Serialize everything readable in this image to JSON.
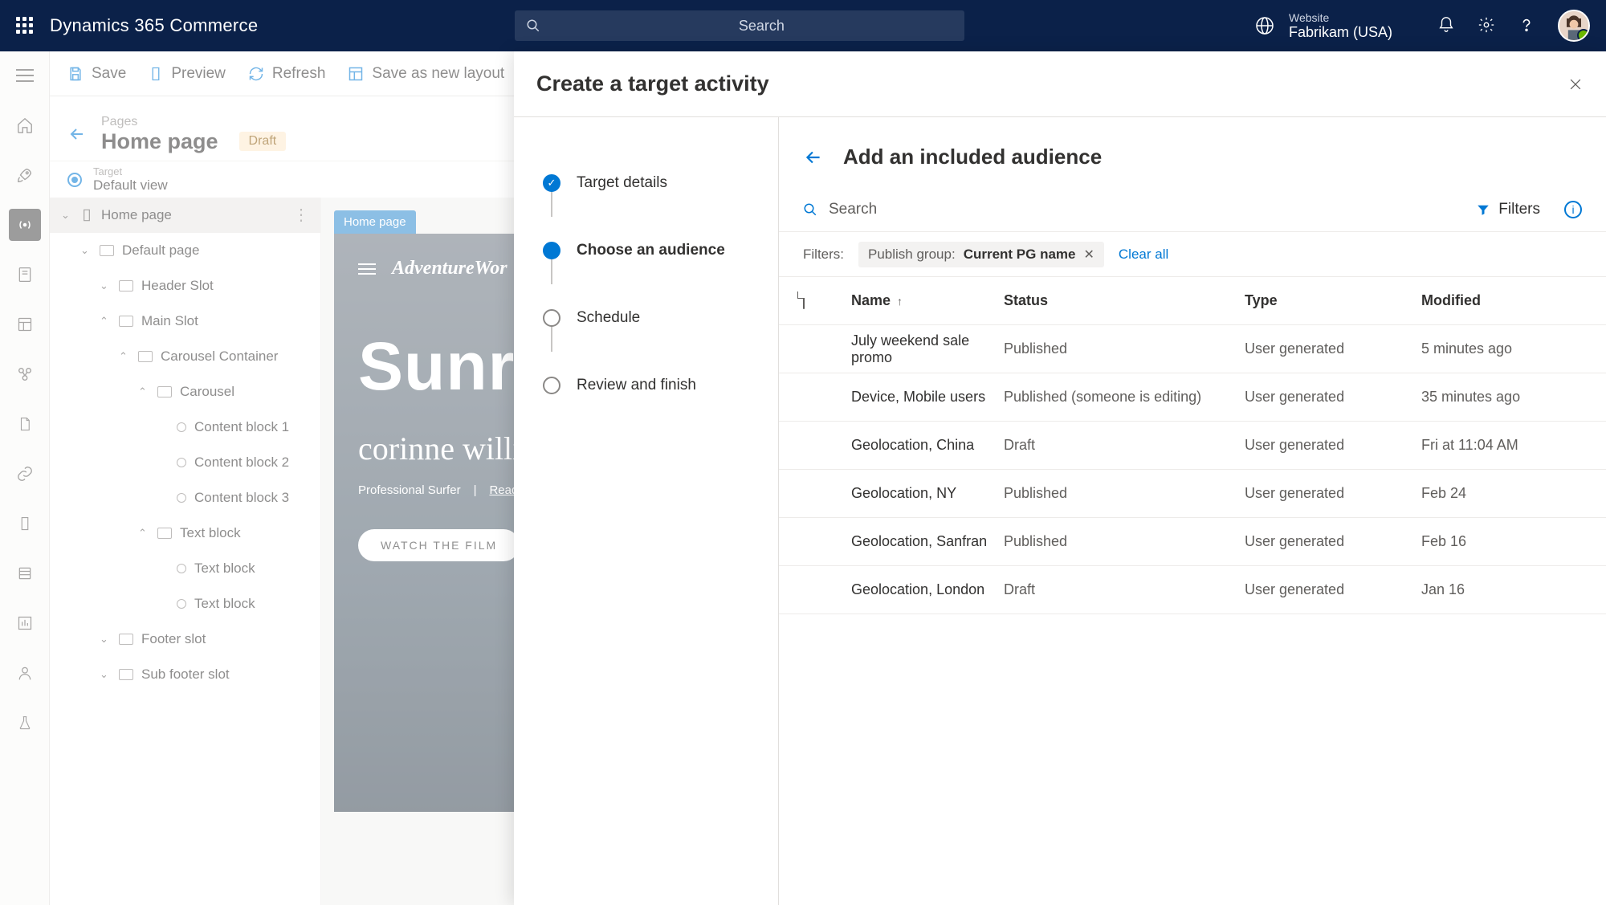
{
  "topbar": {
    "app_title": "Dynamics 365 Commerce",
    "search_placeholder": "Search",
    "website_label": "Website",
    "website_value": "Fabrikam (USA)"
  },
  "toolbar": {
    "save": "Save",
    "preview": "Preview",
    "refresh": "Refresh",
    "save_as_layout": "Save as new layout"
  },
  "page_header": {
    "breadcrumb": "Pages",
    "title": "Home page",
    "status_badge": "Draft"
  },
  "target_line": {
    "label": "Target",
    "value": "Default view"
  },
  "tree": {
    "root": "Home page",
    "items": [
      {
        "label": "Default page",
        "indent": 1,
        "open": true
      },
      {
        "label": "Header Slot",
        "indent": 2,
        "open": true
      },
      {
        "label": "Main Slot",
        "indent": 2,
        "open": false,
        "up": true
      },
      {
        "label": "Carousel Container",
        "indent": 3,
        "open": false,
        "up": true
      },
      {
        "label": "Carousel",
        "indent": 4,
        "open": false,
        "up": true
      },
      {
        "label": "Content block 1",
        "indent": 5,
        "leaf": true
      },
      {
        "label": "Content block 2",
        "indent": 5,
        "leaf": true
      },
      {
        "label": "Content block 3",
        "indent": 5,
        "leaf": true
      },
      {
        "label": "Text block",
        "indent": 4,
        "open": false,
        "up": true
      },
      {
        "label": "Text block",
        "indent": 5,
        "leaf": true
      },
      {
        "label": "Text block",
        "indent": 5,
        "leaf": true
      },
      {
        "label": "Footer slot",
        "indent": 2,
        "open": true
      },
      {
        "label": "Sub footer slot",
        "indent": 2,
        "open": true
      }
    ]
  },
  "canvas": {
    "tab": "Home page",
    "brand": "AdventureWor",
    "hero_title": "Sunr",
    "hero_script": "corinne willi",
    "hero_sub1": "Professional Surfer",
    "hero_sub2": "Read t",
    "hero_button": "WATCH THE FILM"
  },
  "panel": {
    "title": "Create a target activity",
    "steps": [
      {
        "label": "Target details",
        "state": "done"
      },
      {
        "label": "Choose an audience",
        "state": "current"
      },
      {
        "label": "Schedule",
        "state": "todo"
      },
      {
        "label": "Review and finish",
        "state": "todo"
      }
    ],
    "audience": {
      "title": "Add an included audience",
      "search": "Search",
      "filters_btn": "Filters",
      "filters_label": "Filters:",
      "chip_label": "Publish group:",
      "chip_value": "Current PG name",
      "clear_all": "Clear all",
      "columns": {
        "name": "Name",
        "status": "Status",
        "type": "Type",
        "modified": "Modified"
      },
      "rows": [
        {
          "name": "July weekend sale promo",
          "status": "Published",
          "type": "User generated",
          "modified": "5 minutes ago"
        },
        {
          "name": "Device, Mobile users",
          "status": "Published (someone is editing)",
          "type": "User generated",
          "modified": "35 minutes ago"
        },
        {
          "name": "Geolocation, China",
          "status": "Draft",
          "type": "User generated",
          "modified": "Fri at 11:04 AM"
        },
        {
          "name": "Geolocation, NY",
          "status": "Published",
          "type": "User generated",
          "modified": "Feb 24"
        },
        {
          "name": "Geolocation, Sanfran",
          "status": "Published",
          "type": "User generated",
          "modified": "Feb 16"
        },
        {
          "name": "Geolocation, London",
          "status": "Draft",
          "type": "User generated",
          "modified": "Jan 16"
        }
      ]
    }
  }
}
